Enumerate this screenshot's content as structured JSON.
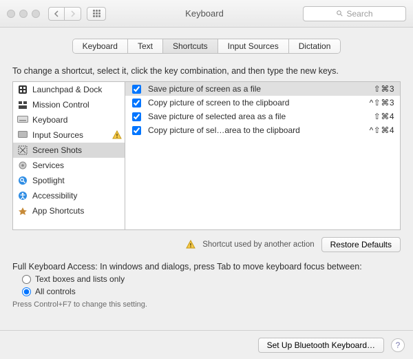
{
  "window": {
    "title": "Keyboard"
  },
  "search": {
    "placeholder": "Search"
  },
  "tabs": {
    "t0": "Keyboard",
    "t1": "Text",
    "t2": "Shortcuts",
    "t3": "Input Sources",
    "t4": "Dictation"
  },
  "instruction": "To change a shortcut, select it, click the key combination, and then type the new keys.",
  "categories": {
    "0": {
      "label": "Launchpad & Dock",
      "icon": "launchpad-icon"
    },
    "1": {
      "label": "Mission Control",
      "icon": "mission-control-icon"
    },
    "2": {
      "label": "Keyboard",
      "icon": "keyboard-icon"
    },
    "3": {
      "label": "Input Sources",
      "icon": "input-sources-icon",
      "warning": true
    },
    "4": {
      "label": "Screen Shots",
      "icon": "screenshot-icon",
      "selected": true
    },
    "5": {
      "label": "Services",
      "icon": "services-icon"
    },
    "6": {
      "label": "Spotlight",
      "icon": "spotlight-icon"
    },
    "7": {
      "label": "Accessibility",
      "icon": "accessibility-icon"
    },
    "8": {
      "label": "App Shortcuts",
      "icon": "app-shortcuts-icon"
    }
  },
  "shortcuts": {
    "0": {
      "enabled": true,
      "label": "Save picture of screen as a file",
      "keys": "⇧⌘3",
      "selected": true
    },
    "1": {
      "enabled": true,
      "label": "Copy picture of screen to the clipboard",
      "keys": "^⇧⌘3"
    },
    "2": {
      "enabled": true,
      "label": "Save picture of selected area as a file",
      "keys": "⇧⌘4"
    },
    "3": {
      "enabled": true,
      "label": "Copy picture of sel…area to the clipboard",
      "keys": "^⇧⌘4"
    }
  },
  "conflict_note": "Shortcut used by another action",
  "restore_label": "Restore Defaults",
  "fka": {
    "heading": "Full Keyboard Access: In windows and dialogs, press Tab to move keyboard focus between:",
    "opt0": "Text boxes and lists only",
    "opt1": "All controls",
    "hint": "Press Control+F7 to change this setting."
  },
  "footer": {
    "bluetooth": "Set Up Bluetooth Keyboard…"
  }
}
